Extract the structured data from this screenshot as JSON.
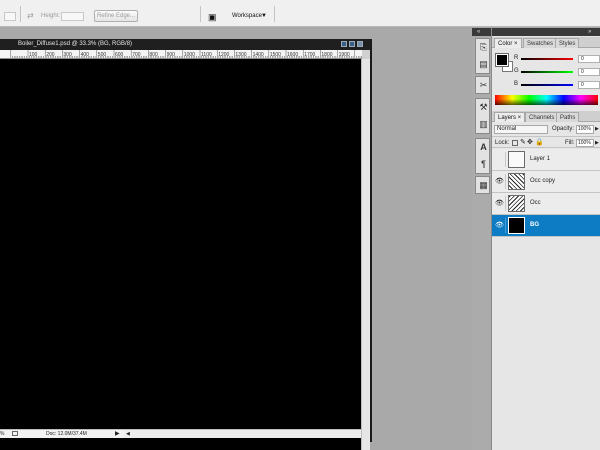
{
  "options_bar": {
    "height_label": "Height:",
    "refine_edge_label": "Refine Edge...",
    "workspace_label": "Workspace"
  },
  "document": {
    "title": "Boiler_Diffuse1.psd @ 33.3% (BG, RGB/8)",
    "ruler_ticks": [
      "100",
      "200",
      "300",
      "400",
      "500",
      "600",
      "700",
      "800",
      "900",
      "1000",
      "1100",
      "1200",
      "1300",
      "1400",
      "1500",
      "1600",
      "1700",
      "1800",
      "1900"
    ],
    "zoom": "%",
    "doc_size": "Doc: 12.0M/37.4M"
  },
  "color_panel": {
    "tabs": [
      "Color",
      "Swatches",
      "Styles"
    ],
    "channels": [
      {
        "letter": "R",
        "value": "0",
        "color": "#ff0000"
      },
      {
        "letter": "G",
        "value": "0",
        "color": "#00ff00"
      },
      {
        "letter": "B",
        "value": "0",
        "color": "#0000ff"
      }
    ]
  },
  "layers_panel": {
    "tabs": [
      "Layers",
      "Channels",
      "Paths"
    ],
    "blend_mode": "Normal",
    "opacity_label": "Opacity:",
    "opacity_value": "100%",
    "lock_label": "Lock:",
    "fill_label": "Fill:",
    "fill_value": "100%",
    "layers": [
      {
        "name": "Layer 1",
        "visible": false,
        "thumb": "white",
        "selected": false
      },
      {
        "name": "Occ copy",
        "visible": true,
        "thumb": "texture",
        "selected": false
      },
      {
        "name": "Occ",
        "visible": true,
        "thumb": "texture",
        "selected": false
      },
      {
        "name": "BG",
        "visible": true,
        "thumb": "black",
        "selected": true
      }
    ]
  },
  "colors": {
    "selection": "#0e7cc4",
    "canvas": "#000000",
    "app_background": "#a9a9a9"
  }
}
